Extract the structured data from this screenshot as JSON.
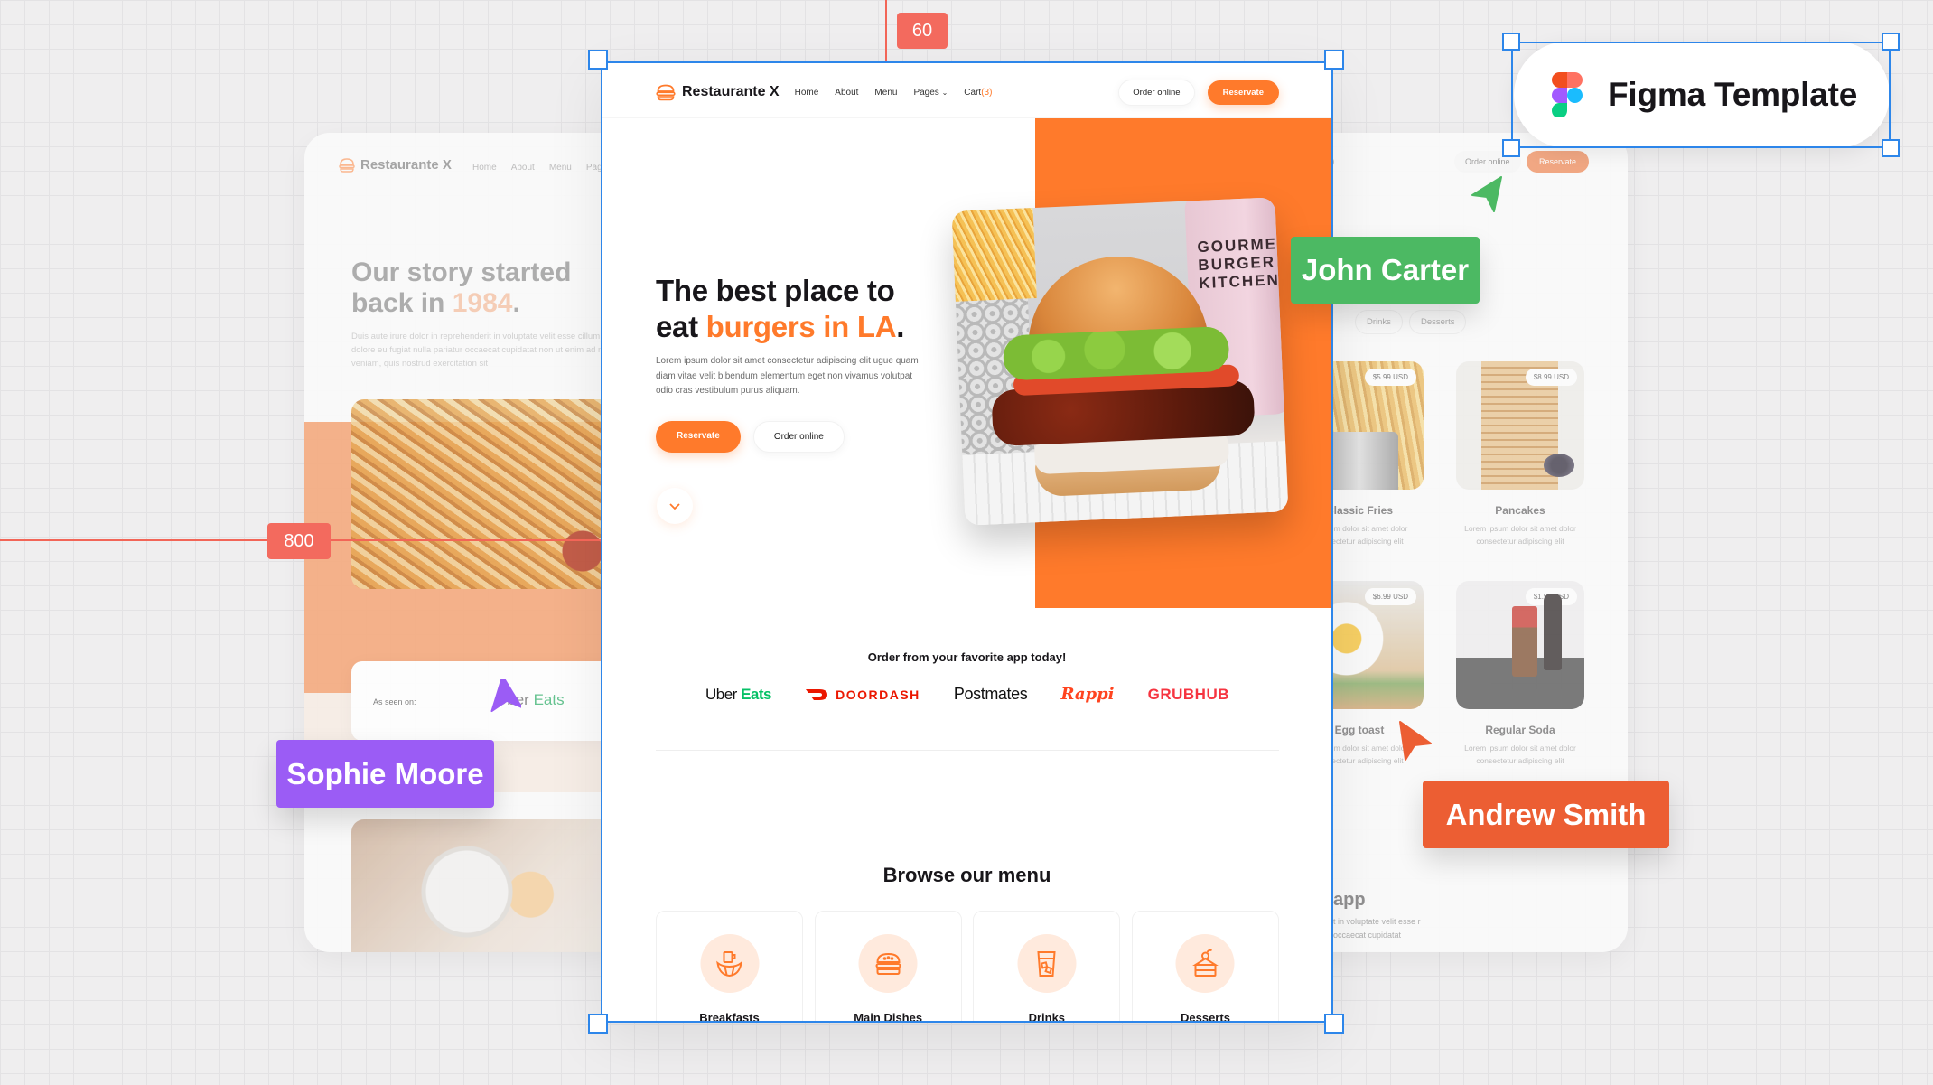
{
  "canvas": {
    "rulers": {
      "vertical_label": "60",
      "horizontal_label": "800"
    },
    "badge": {
      "label": "Figma Template",
      "icon": "figma-logo-icon"
    },
    "collaborators": [
      {
        "name": "John Carter",
        "color": "#4cb963",
        "cursor_color": "#4cb963"
      },
      {
        "name": "Sophie Moore",
        "color": "#9b5cf5",
        "cursor_color": "#9b5cf5"
      },
      {
        "name": "Andrew Smith",
        "color": "#ec5e33",
        "cursor_color": "#ec5e33"
      }
    ]
  },
  "brand": {
    "name": "Restaurante X",
    "accent": "#ff7a2b"
  },
  "nav": {
    "links": [
      "Home",
      "About",
      "Menu",
      "Pages",
      "Cart"
    ],
    "cart_count": "(3)",
    "order_online": "Order online",
    "reservate": "Reservate"
  },
  "hero": {
    "title_line1": "The best place to",
    "title_line2_prefix": "eat ",
    "title_highlight": "burgers in LA",
    "title_suffix": ".",
    "text": "Lorem ipsum dolor sit amet consectetur adipiscing elit ugue quam diam vitae velit bibendum elementum eget non vivamus volutpat odio cras vestibulum purus aliquam.",
    "primary_button": "Reservate",
    "secondary_button": "Order online",
    "image_text": "GOURMET BURGER KITCHEN"
  },
  "apps": {
    "title": "Order from your favorite app today!",
    "uber_prefix": "Uber",
    "uber_suffix": "Eats",
    "doordash": "DOORDASH",
    "postmates": "Postmates",
    "rappi": "Rappi",
    "grubhub": "GRUBHUB"
  },
  "browse": {
    "title": "Browse our menu",
    "categories": [
      {
        "label": "Breakfasts",
        "icon": "croissant-coffee-icon"
      },
      {
        "label": "Main Dishes",
        "icon": "burger-icon"
      },
      {
        "label": "Drinks",
        "icon": "drink-glass-icon"
      },
      {
        "label": "Desserts",
        "icon": "cake-slice-icon"
      }
    ]
  },
  "about_page": {
    "nav_links": [
      "Home",
      "About",
      "Menu",
      "Page"
    ],
    "title_line1": "Our story started",
    "title_line2_prefix": "back in ",
    "title_highlight": "1984",
    "title_suffix": ".",
    "text": "Duis aute irure dolor in reprehenderit in voluptate velit esse cillum dolore eu fugiat nulla pariatur occaecat cupidatat non ut enim ad m veniam, quis nostrud exercitation sit",
    "seen_on_label": "As seen on:",
    "seen_on_logo_prefix": "Uber",
    "seen_on_logo_suffix": "Eats"
  },
  "menu_page": {
    "nav_cart_tail": ")",
    "order_online": "Order online",
    "reservate": "Reservate",
    "tabs": [
      "Drinks",
      "Desserts"
    ],
    "items": [
      {
        "name": "Classic Fries",
        "price": "$5.99 USD",
        "desc": "m ipsum dolor sit amet dolor consectetur adipiscing elit"
      },
      {
        "name": "Pancakes",
        "price": "$8.99 USD",
        "desc": "Lorem ipsum dolor sit amet dolor consectetur adipiscing elit"
      },
      {
        "name": "Egg toast",
        "price": "$6.99 USD",
        "desc": "m ipsum dolor sit amet dolor consectetur adipiscing elit"
      },
      {
        "name": "Regular Soda",
        "price": "$1.99 USD",
        "desc": "Lorem ipsum dolor sit amet dolor consectetur adipiscing elit"
      }
    ],
    "app_title": "app",
    "app_text": "t in voluptate velit esse r occaecat cupidatat"
  }
}
